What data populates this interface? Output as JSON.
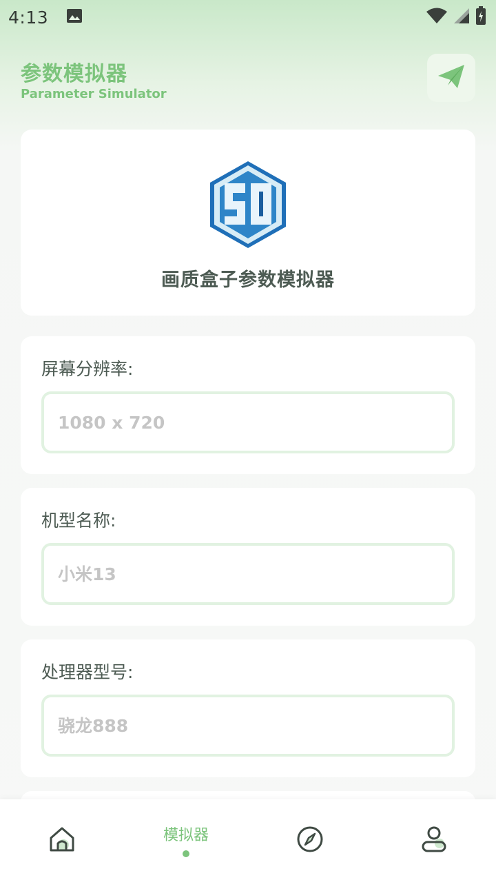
{
  "status_bar": {
    "time": "4:13",
    "icons": [
      "image-notification-icon",
      "wifi-icon",
      "signal-icon",
      "battery-icon"
    ]
  },
  "header": {
    "title": "参数模拟器",
    "subtitle": "Parameter Simulator",
    "send_icon": "paper-plane-icon"
  },
  "logo_card": {
    "logo_icon": "sd-hexagon-logo",
    "caption": "画质盒子参数模拟器"
  },
  "fields": [
    {
      "label": "屏幕分辨率:",
      "placeholder": "1080 x 720"
    },
    {
      "label": "机型名称:",
      "placeholder": "小米13"
    },
    {
      "label": "处理器型号:",
      "placeholder": "骁龙888"
    }
  ],
  "bottom_nav": {
    "items": [
      {
        "icon": "home-icon"
      },
      {
        "label": "模拟器",
        "active": true
      },
      {
        "icon": "compass-icon"
      },
      {
        "icon": "profile-icon"
      }
    ]
  },
  "colors": {
    "accent": "#7cc47c",
    "input_border": "#e1f2e1",
    "text_dark": "#4d5b53"
  }
}
